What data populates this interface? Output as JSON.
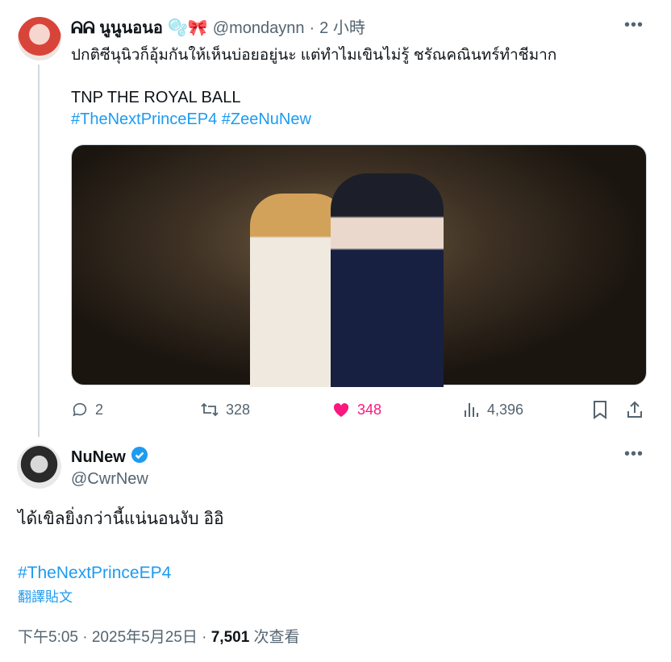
{
  "parent_tweet": {
    "display_name": "ᕱᕱ นูนูนอนอ",
    "emojis": "🫧🎀",
    "handle": "@mondaynn",
    "separator": "·",
    "time": "2 小時",
    "text_line1": "ปกติซีนุนิวก็อุ้มกันให้เห็นบ่อยอยู่นะ แต่ทำไมเขินไม่รู้ ชรัณคณินทร์ทำชีมาก",
    "text_line2": "TNP THE ROYAL BALL",
    "hashtags": "#TheNextPrinceEP4 #ZeeNuNew",
    "more_label": "•••",
    "actions": {
      "replies": "2",
      "retweets": "328",
      "likes": "348",
      "views": "4,396"
    }
  },
  "main_tweet": {
    "display_name": "NuNew",
    "verified": true,
    "handle": "@CwrNew",
    "more_label": "•••",
    "text": "ได้เขิลยิ่งกว่านี้แน่นอนงับ อิอิ",
    "hashtag": "#TheNextPrinceEP4",
    "translate_label": "翻譯貼文",
    "meta_time": "下午5:05 · 2025年5月25日 · ",
    "meta_views_count": "7,501",
    "meta_views_label": " 次查看"
  },
  "colors": {
    "text": "#0f1419",
    "muted": "#536471",
    "link": "#1d9bf0",
    "like": "#f91880",
    "thread_line": "#cfd9de"
  }
}
